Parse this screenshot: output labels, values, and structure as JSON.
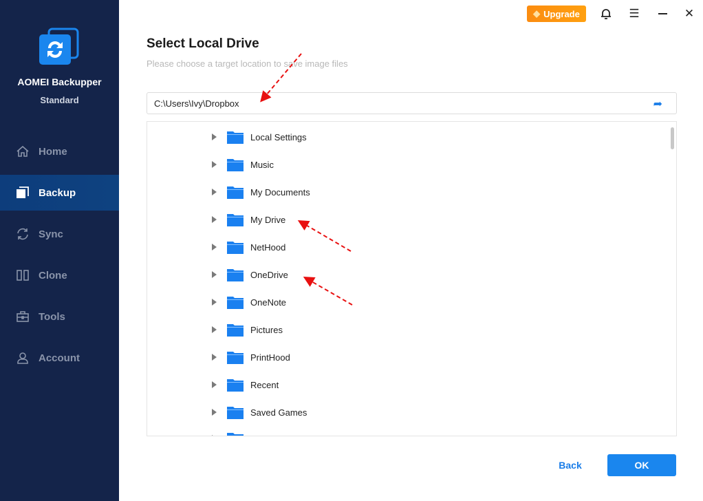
{
  "app": {
    "name": "AOMEI Backupper",
    "edition": "Standard"
  },
  "sidebar": {
    "items": [
      {
        "label": "Home",
        "icon": "home-icon"
      },
      {
        "label": "Backup",
        "icon": "backup-icon",
        "active": true
      },
      {
        "label": "Sync",
        "icon": "sync-icon"
      },
      {
        "label": "Clone",
        "icon": "clone-icon"
      },
      {
        "label": "Tools",
        "icon": "tools-icon"
      },
      {
        "label": "Account",
        "icon": "account-icon"
      }
    ]
  },
  "topbar": {
    "upgrade_label": "Upgrade"
  },
  "dialog": {
    "title": "Select Local Drive",
    "subtitle": "Please choose a target location to save image files",
    "path_value": "C:\\Users\\Ivy\\Dropbox",
    "folders": [
      "Local Settings",
      "Music",
      "My Documents",
      "My Drive",
      "NetHood",
      "OneDrive",
      "OneNote",
      "Pictures",
      "PrintHood",
      "Recent",
      "Saved Games"
    ],
    "back_label": "Back",
    "ok_label": "OK"
  },
  "colors": {
    "sidebar": "#14244a",
    "accent": "#1a86ee",
    "upgrade": "#fb8c10",
    "annotation": "#e81010"
  }
}
